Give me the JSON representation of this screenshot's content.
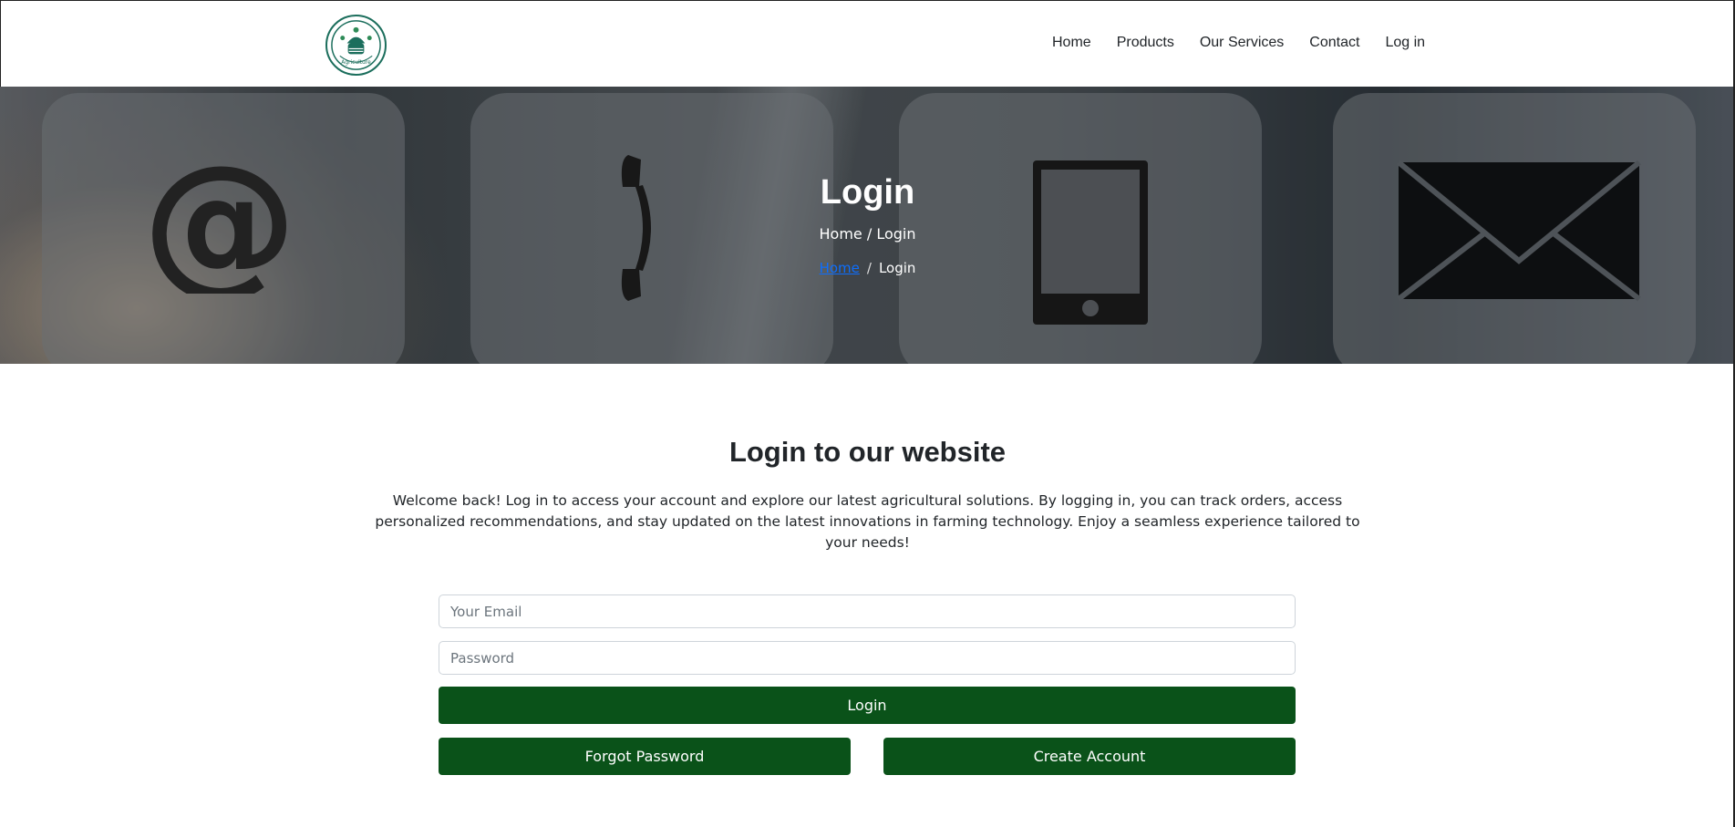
{
  "logo": {
    "icon": "agriculture-logo",
    "text": "Agriculture",
    "color": "#1b6e5c"
  },
  "nav": {
    "items": [
      {
        "label": "Home"
      },
      {
        "label": "Products"
      },
      {
        "label": "Our Services"
      },
      {
        "label": "Contact"
      },
      {
        "label": "Log in"
      }
    ]
  },
  "hero": {
    "title": "Login",
    "subtitle": "Home / Login",
    "breadcrumb": {
      "home": "Home",
      "separator": "/",
      "current": "Login"
    },
    "tiles": [
      "at-sign-icon",
      "phone-handset-icon",
      "tablet-icon",
      "envelope-icon"
    ]
  },
  "content": {
    "heading": "Login to our website",
    "description": "Welcome back! Log in to access your account and explore our latest agricultural solutions. By logging in, you can track orders, access personalized recommendations, and stay updated on the latest innovations in farming technology. Enjoy a seamless experience tailored to your needs!"
  },
  "form": {
    "email_placeholder": "Your Email",
    "email_value": "",
    "password_placeholder": "Password",
    "password_value": "",
    "login_label": "Login",
    "forgot_label": "Forgot Password",
    "create_label": "Create Account"
  },
  "colors": {
    "primary_button": "#0a5219",
    "link": "#0d6efd",
    "text": "#212529"
  }
}
